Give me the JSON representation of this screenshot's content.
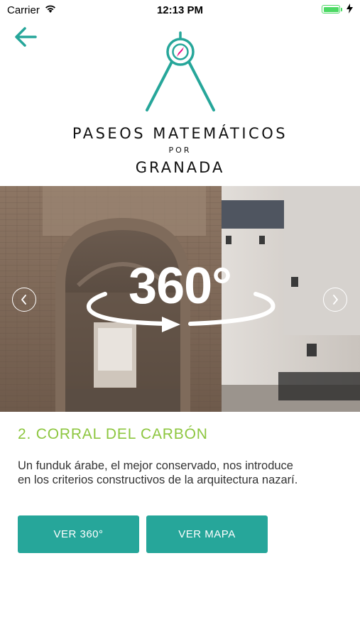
{
  "status_bar": {
    "carrier": "Carrier",
    "time": "12:13 PM"
  },
  "brand": {
    "line1": "PASEOS MATEMÁTICOS",
    "line2": "POR",
    "line3": "GRANADA"
  },
  "carousel": {
    "badge": "360°"
  },
  "place": {
    "title": "2. CORRAL DEL CARBÓN",
    "description": "Un funduk árabe, el mejor conservado, nos introduce en los criterios constructivos de la arquitectura nazarí."
  },
  "actions": {
    "view_360": "VER 360°",
    "view_map": "VER MAPA"
  },
  "colors": {
    "teal": "#26a69a",
    "green": "#8dc63f",
    "magenta": "#e6007e"
  },
  "icons": [
    "back-arrow-icon",
    "compass-icon",
    "chevron-left-icon",
    "chevron-right-icon",
    "wifi-icon",
    "battery-icon",
    "charging-bolt-icon"
  ]
}
